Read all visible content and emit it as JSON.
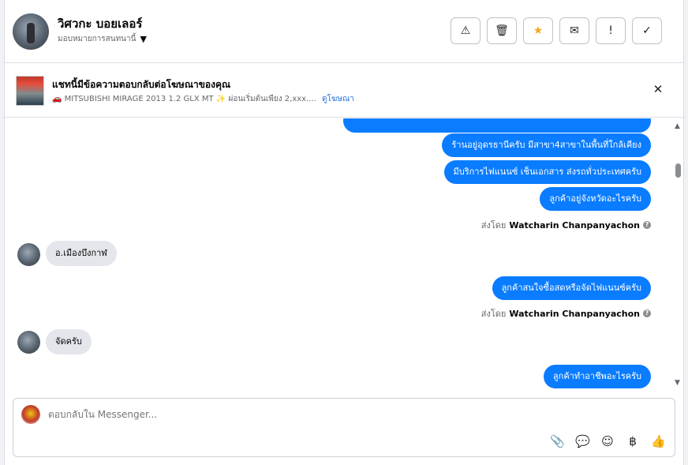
{
  "header": {
    "contact_name": "วิศวกะ บอยเลอร์",
    "assign_label": "มอบหมายการสนทนานี้",
    "actions": [
      {
        "name": "report",
        "icon": "⚠"
      },
      {
        "name": "delete",
        "icon": "🗑"
      },
      {
        "name": "star",
        "icon": "★"
      },
      {
        "name": "mail",
        "icon": "✉"
      },
      {
        "name": "spam",
        "icon": "!"
      },
      {
        "name": "done",
        "icon": "✓"
      }
    ]
  },
  "ad_banner": {
    "title": "แชทนี้มีข้อความตอบกลับต่อโฆษณาของคุณ",
    "car_icon": "🚗",
    "ad_text": "MITSUBISHI MIRAGE 2013 1.2 GLX MT",
    "spark_icon": "✨",
    "ad_text_2": "ผ่อนเริ่มต้นเพียง 2,xxx....",
    "view_ad_link": "ดูโฆษณา"
  },
  "messages": {
    "m1": "ร้านอยู่อุดรธานีครับ มีสาขา4สาขาในพื้นที่ใกล้เคียง",
    "m2": "มีบริการไฟแนนซ์ เช็นเอกสาร ส่งรถทั่วประเทศครับ",
    "m3": "ลูกค้าอยู่จังหวัดอะไรครับ",
    "sent_by_label": "ส่งโดย",
    "sender_name": "Watcharin Chanpanyachon",
    "in1": "อ.เมืองบึงกาฬ",
    "m4": "ลูกค้าสนใจซื้อสดหรือจัดไฟแนนซ์ครับ",
    "in2": "จัดครับ",
    "m5": "ลูกค้าทำอาชีพอะไรครับ"
  },
  "composer": {
    "placeholder": "ตอบกลับใน Messenger..."
  },
  "colors": {
    "outgoing_bubble": "#0a7cff",
    "incoming_bubble": "#e4e6eb",
    "link": "#216fdb"
  }
}
